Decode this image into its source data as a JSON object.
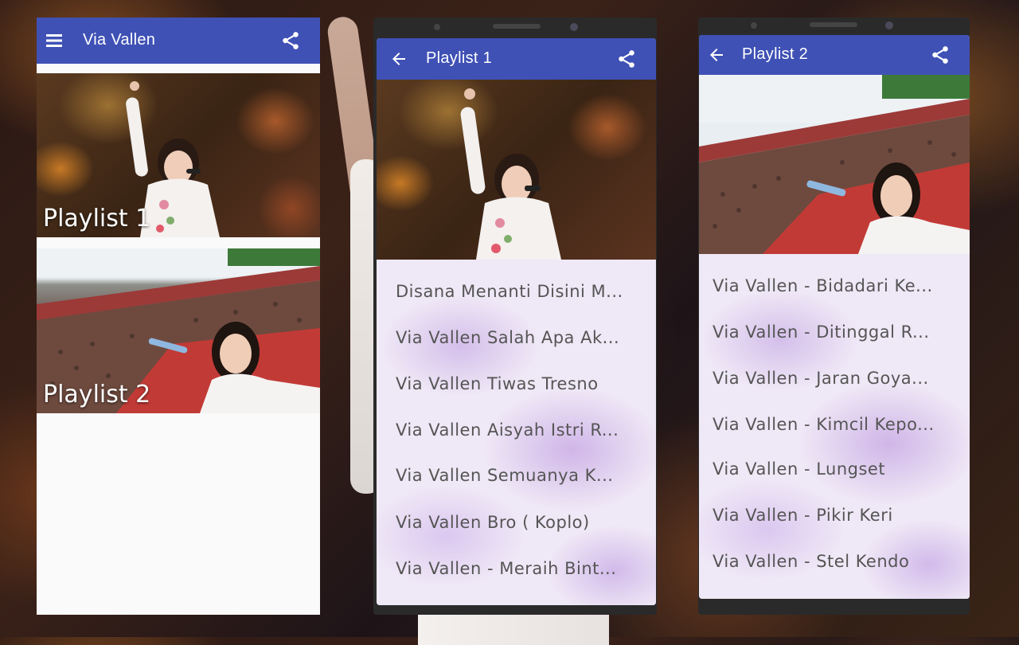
{
  "screen1": {
    "title": "Via Vallen",
    "menu_icon": "menu-icon",
    "share_icon": "share-icon",
    "cards": [
      {
        "label": "Playlist 1"
      },
      {
        "label": "Playlist 2"
      }
    ]
  },
  "screen2": {
    "title": "Playlist 1",
    "back_icon": "arrow-back-icon",
    "share_icon": "share-icon",
    "songs": [
      "Disana Menanti Disini M...",
      "Via Vallen Salah Apa Ak...",
      "Via Vallen Tiwas Tresno",
      "Via Vallen Aisyah Istri R...",
      "Via Vallen Semuanya K...",
      "Via Vallen Bro ( Koplo)",
      "Via Vallen - Meraih Bint..."
    ]
  },
  "screen3": {
    "title": "Playlist 2",
    "back_icon": "arrow-back-icon",
    "share_icon": "share-icon",
    "songs": [
      "Via Vallen - Bidadari Ke...",
      "Via Vallen - Ditinggal R...",
      "Via Vallen - Jaran Goya...",
      "Via Vallen - Kimcil Kepo...",
      "Via Vallen - Lungset",
      "Via Vallen - Pikir Keri",
      "Via Vallen - Stel Kendo"
    ]
  },
  "colors": {
    "appbar": "#3f51b5",
    "list_background": "#efe8f6",
    "song_text": "#555555"
  }
}
